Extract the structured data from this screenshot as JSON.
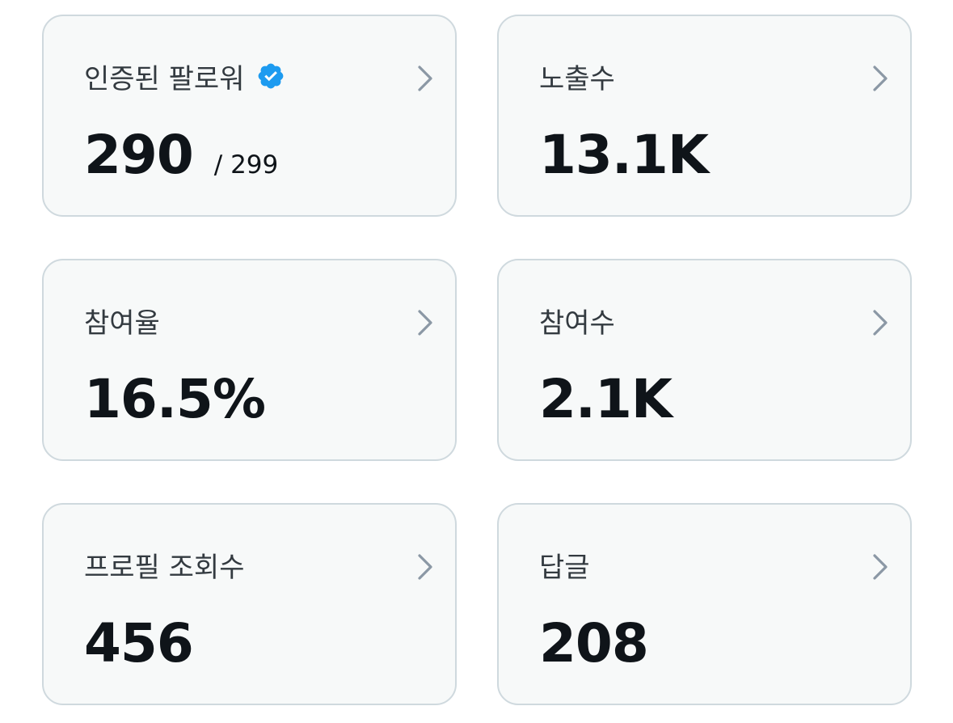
{
  "cards": [
    {
      "label": "인증된 팔로워",
      "value": "290",
      "subvalue": "/ 299",
      "icon": "verified-badge-icon"
    },
    {
      "label": "노출수",
      "value": "13.1K"
    },
    {
      "label": "참여율",
      "value": "16.5%"
    },
    {
      "label": "참여수",
      "value": "2.1K"
    },
    {
      "label": "프로필 조회수",
      "value": "456"
    },
    {
      "label": "답글",
      "value": "208"
    }
  ],
  "colors": {
    "card_background": "#f7f9f9",
    "card_border": "#cfd9de",
    "label_text": "#333a40",
    "value_text": "#0f1419",
    "verified_badge": "#1d9bf0",
    "chevron": "#8b98a5"
  }
}
